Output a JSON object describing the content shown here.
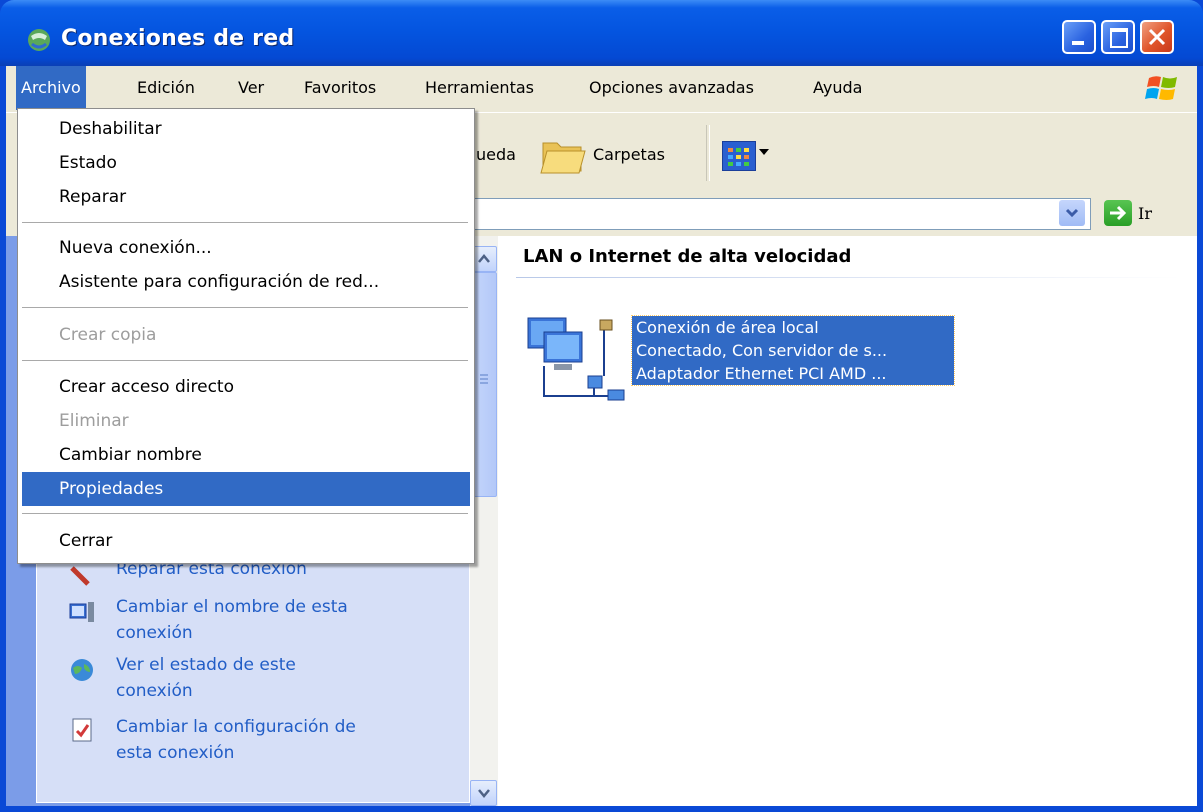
{
  "window": {
    "title": "Conexiones de red",
    "accent": "#0a49d6"
  },
  "menubar": {
    "items": [
      "Archivo",
      "Edición",
      "Ver",
      "Favoritos",
      "Herramientas",
      "Opciones avanzadas",
      "Ayuda"
    ],
    "active": "Archivo"
  },
  "toolbar": {
    "search_label_partial": "ueda",
    "folders_label": "Carpetas",
    "views_icon": "views-icon"
  },
  "addressbar": {
    "go_label": "Ir"
  },
  "file_menu": {
    "items": [
      {
        "label": "Deshabilitar",
        "state": "enabled"
      },
      {
        "label": "Estado",
        "state": "enabled"
      },
      {
        "label": "Reparar",
        "state": "enabled"
      },
      {
        "label": "Nueva conexión...",
        "state": "enabled"
      },
      {
        "label": "Asistente para configuración de red...",
        "state": "enabled"
      },
      {
        "label": "Crear copia",
        "state": "disabled"
      },
      {
        "label": "Crear acceso directo",
        "state": "enabled"
      },
      {
        "label": "Eliminar",
        "state": "disabled"
      },
      {
        "label": "Cambiar nombre",
        "state": "enabled"
      },
      {
        "label": "Propiedades",
        "state": "selected"
      },
      {
        "label": "Cerrar",
        "state": "enabled"
      }
    ]
  },
  "task_pane": {
    "partial_link": "Reparar esta conexión",
    "links": [
      {
        "label_line1": "Cambiar el nombre de esta",
        "label_line2": "conexión",
        "icon": "rename-icon"
      },
      {
        "label_line1": "Ver el estado de este",
        "label_line2": "conexión",
        "icon": "status-globe-icon"
      },
      {
        "label_line1": "Cambiar la configuración de",
        "label_line2": "esta conexión",
        "icon": "settings-document-icon"
      }
    ]
  },
  "content": {
    "group_header": "LAN o Internet de alta velocidad",
    "connection": {
      "name": "Conexión de área local",
      "status": "Conectado, Con servidor de s...",
      "device": "Adaptador Ethernet PCI AMD ..."
    }
  }
}
